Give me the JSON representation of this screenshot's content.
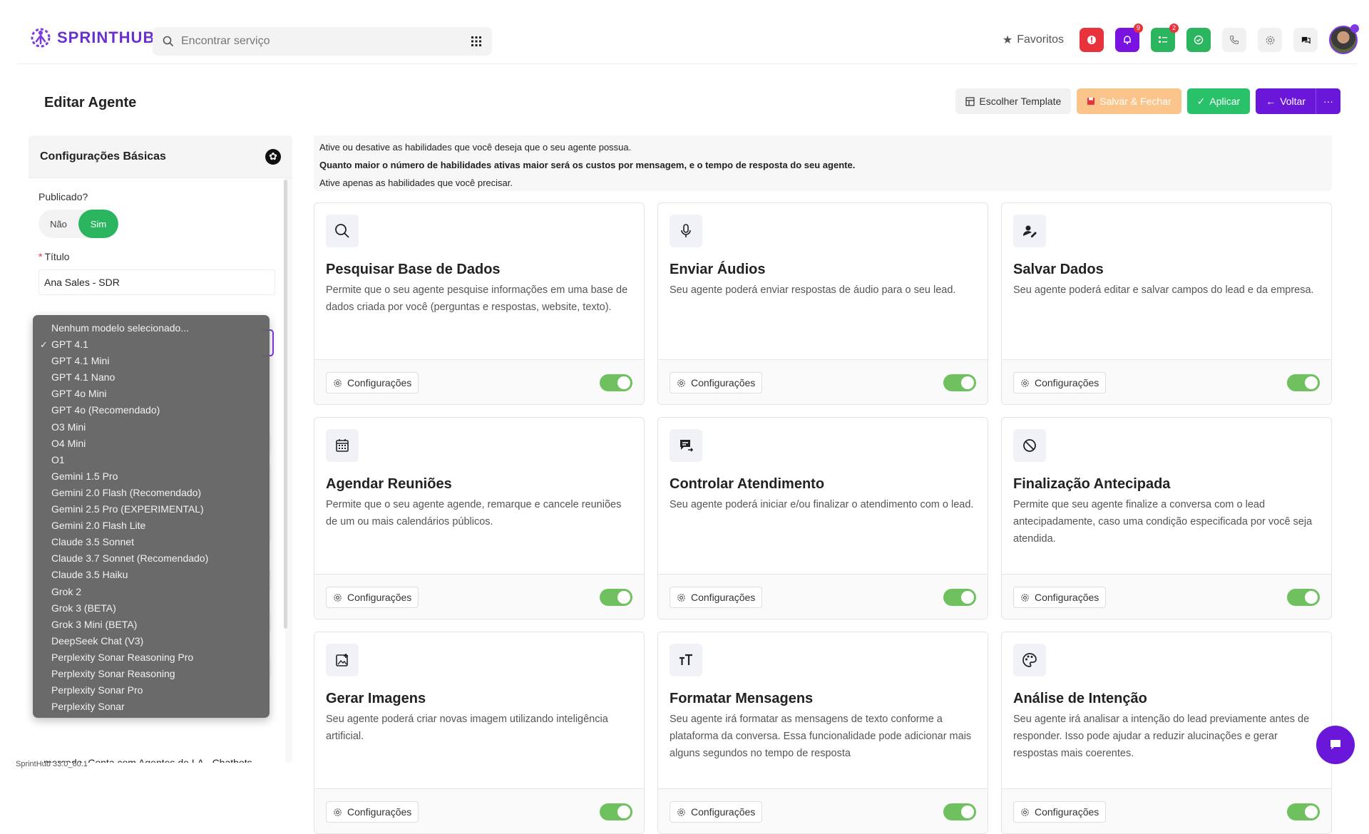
{
  "brand": {
    "name": "SPRINTHUB",
    "accent": "#6a17d9"
  },
  "search": {
    "placeholder": "Encontrar serviço"
  },
  "topbar": {
    "favorites_label": "Favoritos",
    "notif_badges": {
      "bell": "9",
      "tasks": "2"
    }
  },
  "header": {
    "title": "Editar Agente",
    "buttons": {
      "template": "Escolher Template",
      "save_close": "Salvar & Fechar",
      "apply": "Aplicar",
      "back": "Voltar",
      "more": "···"
    }
  },
  "left": {
    "section_title": "Configurações Básicas",
    "published_label": "Publicado?",
    "published_options": {
      "no": "Não",
      "yes": "Sim"
    },
    "title_label": "Título",
    "title_value": "Ana Sales - SDR",
    "description_preview": "mercado. Conta com Agentes de I.A., Chatbots, plataforma All-in-One de Marketing/Atendimento/Vendas que reúne de"
  },
  "model_dropdown": {
    "selected": "GPT 4.1",
    "options": [
      "Nenhum modelo selecionado...",
      "GPT 4.1",
      "GPT 4.1 Mini",
      "GPT 4.1 Nano",
      "GPT 4o Mini",
      "GPT 4o (Recomendado)",
      "O3 Mini",
      "O4 Mini",
      "O1",
      "Gemini 1.5 Pro",
      "Gemini 2.0 Flash (Recomendado)",
      "Gemini 2.5 Pro (EXPERIMENTAL)",
      "Gemini 2.0 Flash Lite",
      "Claude 3.5 Sonnet",
      "Claude 3.7 Sonnet (Recomendado)",
      "Claude 3.5 Haiku",
      "Grok 2",
      "Grok 3 (BETA)",
      "Grok 3 Mini (BETA)",
      "DeepSeek Chat (V3)",
      "Perplexity Sonar Reasoning Pro",
      "Perplexity Sonar Reasoning",
      "Perplexity Sonar Pro",
      "Perplexity Sonar"
    ]
  },
  "notice": {
    "line1": "Ative ou desative as habilidades que você deseja que o seu agente possua.",
    "line2": "Quanto maior o número de habilidades ativas maior será os custos por mensagem, e o tempo de resposta do seu agente.",
    "line3": "Ative apenas as habilidades que você precisar."
  },
  "skills": [
    {
      "icon": "search-icon",
      "title": "Pesquisar Base de Dados",
      "desc": "Permite que o seu agente pesquise informações em uma base de dados criada por você (perguntas e respostas, website, texto).",
      "config": "Configurações",
      "enabled": true
    },
    {
      "icon": "microphone-icon",
      "title": "Enviar Áudios",
      "desc": "Seu agente poderá enviar respostas de áudio para o seu lead.",
      "config": "Configurações",
      "enabled": true
    },
    {
      "icon": "user-edit-icon",
      "title": "Salvar Dados",
      "desc": "Seu agente poderá editar e salvar campos do lead e da empresa.",
      "config": "Configurações",
      "enabled": true
    },
    {
      "icon": "calendar-icon",
      "title": "Agendar Reuniões",
      "desc": "Permite que o seu agente agende, remarque e cancele reuniões de um ou mais calendários públicos.",
      "config": "Configurações",
      "enabled": true
    },
    {
      "icon": "chat-forward-icon",
      "title": "Controlar Atendimento",
      "desc": "Seu agente poderá iniciar e/ou finalizar o atendimento com o lead.",
      "config": "Configurações",
      "enabled": true
    },
    {
      "icon": "block-icon",
      "title": "Finalização Antecipada",
      "desc": "Permite que seu agente finalize a conversa com o lead antecipadamente, caso uma condição especificada por você seja atendida.",
      "config": "Configurações",
      "enabled": true
    },
    {
      "icon": "image-add-icon",
      "title": "Gerar Imagens",
      "desc": "Seu agente poderá criar novas imagem utilizando inteligência artificial.",
      "config": "Configurações",
      "enabled": true
    },
    {
      "icon": "text-format-icon",
      "title": "Formatar Mensagens",
      "desc": "Seu agente irá formatar as mensagens de texto conforme a plataforma da conversa. Essa funcionalidade pode adicionar mais alguns segundos no tempo de resposta",
      "config": "Configurações",
      "enabled": true
    },
    {
      "icon": "palette-icon",
      "title": "Análise de Intenção",
      "desc": "Seu agente irá analisar a intenção do lead previamente antes de responder. Isso pode ajudar a reduzir alucinações e gerar respostas mais coerentes.",
      "config": "Configurações",
      "enabled": true
    }
  ],
  "footer": {
    "version": "SprintHub 33.0_60.1"
  }
}
